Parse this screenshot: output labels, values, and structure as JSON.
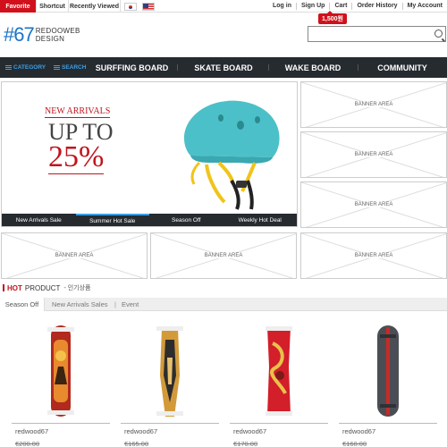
{
  "topbar": {
    "favorite": "Favorite",
    "shortcut": "Shortcut",
    "recently_viewed": "Recently Viewed",
    "flags": [
      "kr-flag-icon",
      "us-flag-icon"
    ],
    "links": [
      "Log in",
      "Sign Up",
      "Cart",
      "Order History",
      "My Account"
    ],
    "points": "1,500원"
  },
  "logo": {
    "number": "#67",
    "line1": "REDOOWEB",
    "line2": "DESIGN"
  },
  "search": {
    "placeholder": "",
    "icon": "search-icon"
  },
  "nav": {
    "category": "CATEGORY",
    "search": "SEARCH",
    "items": [
      "SURFFING BOARD",
      "SKATE BOARD",
      "WAKE BOARD",
      "COMMUNITY"
    ]
  },
  "hero": {
    "new_arrivals": "NEW ARRIVALS",
    "up_to": "UP TO",
    "percent": "25%",
    "tabs": [
      "New Arrivals Sale",
      "Summer Hot Sale",
      "Season Off",
      "Weekly Hot Deal"
    ],
    "active_tab": 1
  },
  "banners": {
    "label": "BANNER AREA"
  },
  "hot": {
    "red": "HOT",
    "rest": "PRODUCT",
    "korean": "- 인기상품",
    "tabs": [
      "Season Off",
      "New Arrivals Sales",
      "|",
      "Event"
    ]
  },
  "products": [
    {
      "name": "redwood67",
      "price": "€200.00"
    },
    {
      "name": "redwood67",
      "price": "€165.00"
    },
    {
      "name": "redwood67",
      "price": "€170.00"
    },
    {
      "name": "redwood67",
      "price": "€160.00"
    }
  ],
  "colors": {
    "accent_red": "#d0111b",
    "nav_bg": "#262b30",
    "accent_blue": "#3aa0e8"
  }
}
